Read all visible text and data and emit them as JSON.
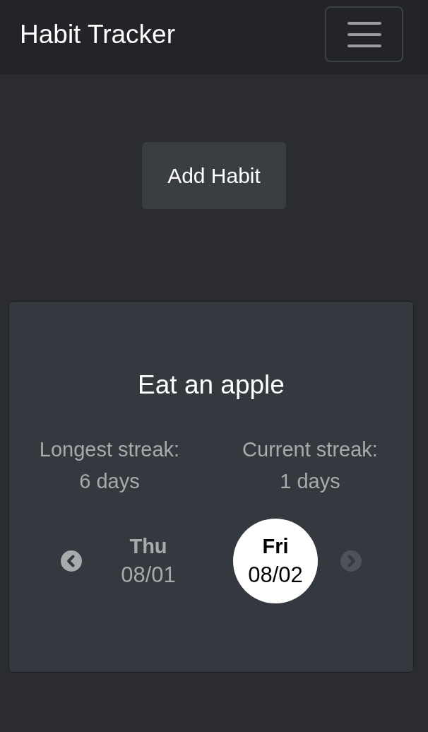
{
  "navbar": {
    "title": "Habit Tracker"
  },
  "add_button": {
    "label": "Add Habit"
  },
  "habits": [
    {
      "name": "Eat an apple",
      "stats": [
        {
          "label": "Longest streak:",
          "value": "6 days"
        },
        {
          "label": "Current streak:",
          "value": "1 days"
        }
      ],
      "prev": {
        "disabled": false
      },
      "next": {
        "disabled": true
      },
      "days": [
        {
          "weekday": "Thu",
          "date": "08/01",
          "selected": false
        },
        {
          "weekday": "Fri",
          "date": "08/02",
          "selected": true
        }
      ]
    }
  ]
}
